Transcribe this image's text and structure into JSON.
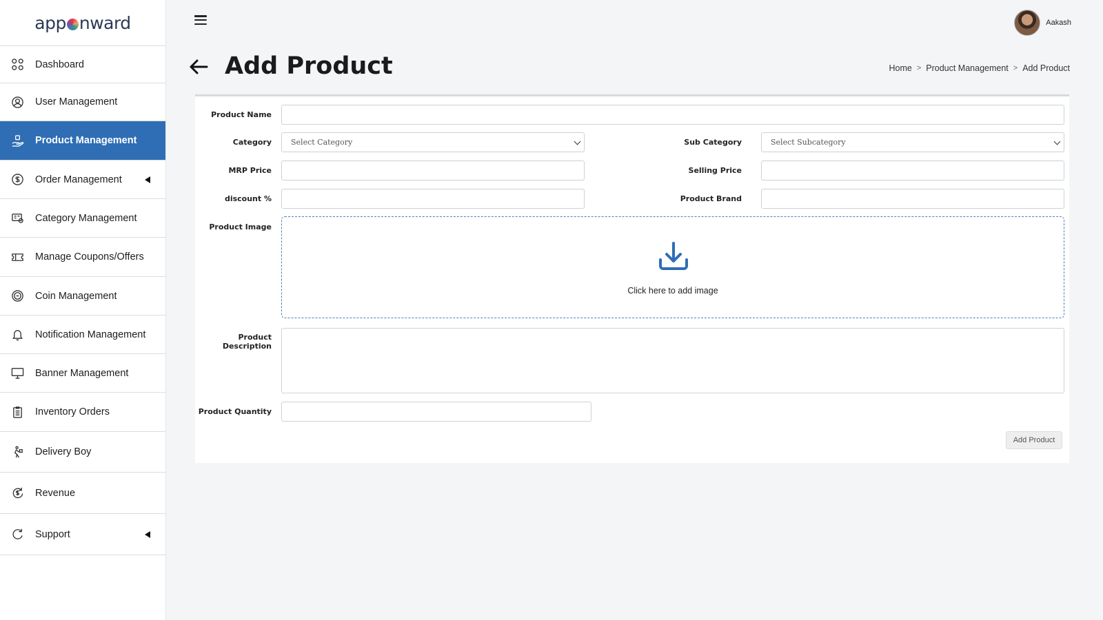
{
  "brand": {
    "logo_left": "app",
    "logo_right": "nward"
  },
  "sidebar": {
    "items": [
      {
        "label": "Dashboard",
        "icon": "dashboard-icon"
      },
      {
        "label": "User Management",
        "icon": "user-icon"
      },
      {
        "label": "Product Management",
        "icon": "product-icon",
        "active": true
      },
      {
        "label": "Order Management",
        "icon": "order-icon",
        "has_submenu": true
      },
      {
        "label": "Category Management",
        "icon": "category-icon"
      },
      {
        "label": "Manage Coupons/Offers",
        "icon": "coupon-icon"
      },
      {
        "label": "Coin Management",
        "icon": "coin-icon"
      },
      {
        "label": "Notification Management",
        "icon": "bell-icon"
      },
      {
        "label": "Banner Management",
        "icon": "monitor-icon"
      },
      {
        "label": "Inventory Orders",
        "icon": "clipboard-icon"
      },
      {
        "label": "Delivery Boy",
        "icon": "delivery-icon"
      },
      {
        "label": "Revenue",
        "icon": "revenue-icon"
      },
      {
        "label": "Support",
        "icon": "support-icon",
        "has_submenu": true
      }
    ]
  },
  "topbar": {
    "user_name": "Aakash"
  },
  "page": {
    "title": "Add Product",
    "breadcrumb": [
      "Home",
      "Product Management",
      "Add Product"
    ],
    "breadcrumb_separator": ">"
  },
  "form": {
    "product_name_label": "Product Name",
    "product_name_value": "",
    "category_label": "Category",
    "category_selected": "Select Category",
    "sub_category_label": "Sub Category",
    "sub_category_selected": "Select Subcategory",
    "mrp_price_label": "MRP Price",
    "mrp_price_value": "",
    "selling_price_label": "Selling Price",
    "selling_price_value": "",
    "discount_label": "discount %",
    "discount_value": "",
    "product_brand_label": "Product Brand",
    "product_brand_value": "",
    "product_image_label": "Product Image",
    "upload_text": "Click here to add image",
    "product_description_label": "Product Description",
    "product_description_value": "",
    "product_quantity_label": "Product Quantity",
    "product_quantity_value": "",
    "submit_label": "Add Product"
  },
  "colors": {
    "accent": "#2f6eb5",
    "upload_icon": "#2f6eb5",
    "page_background": "#f4f5f7"
  }
}
